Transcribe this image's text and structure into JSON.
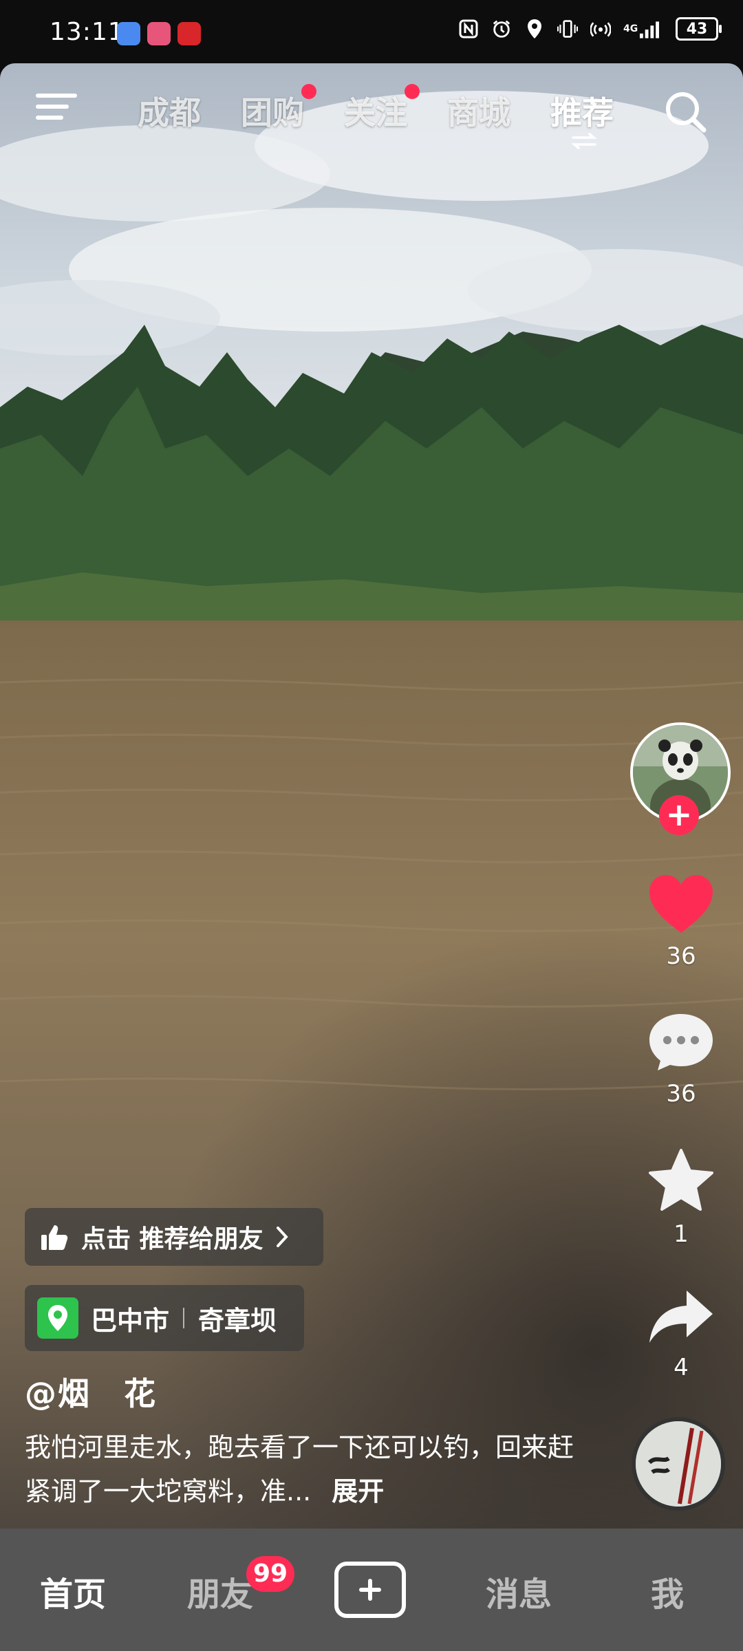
{
  "status_bar": {
    "time": "13:11",
    "battery": "43",
    "network": "4G",
    "icons": [
      "nfc-icon",
      "alarm-icon",
      "location-icon",
      "vibrate-icon",
      "hotspot-icon",
      "signal-icon",
      "battery-icon"
    ]
  },
  "top_nav": {
    "tabs": [
      {
        "label": "成都",
        "dot": false
      },
      {
        "label": "团购",
        "dot": true
      },
      {
        "label": "关注",
        "dot": true
      },
      {
        "label": "商城",
        "dot": false
      },
      {
        "label": "推荐",
        "dot": false,
        "active": true
      }
    ]
  },
  "rail": {
    "likes": "36",
    "comments": "36",
    "favorites": "1",
    "shares": "4",
    "follow_symbol": "+"
  },
  "video_info": {
    "recommend_label": "点击 推荐给朋友",
    "location_city": "巴中市",
    "location_place": "奇章坝",
    "author": "@烟　花",
    "description": "我怕河里走水，跑去看了一下还可以钓，回来赶紧调了一大坨窝料，准...",
    "expand_label": "展开"
  },
  "bottom_nav": {
    "home": "首页",
    "friends": "朋友",
    "friends_badge": "99",
    "messages": "消息",
    "me": "我"
  },
  "colors": {
    "accent": "#fe2c55",
    "location_green": "#2dc34d",
    "bottom_bar": "#555555"
  }
}
